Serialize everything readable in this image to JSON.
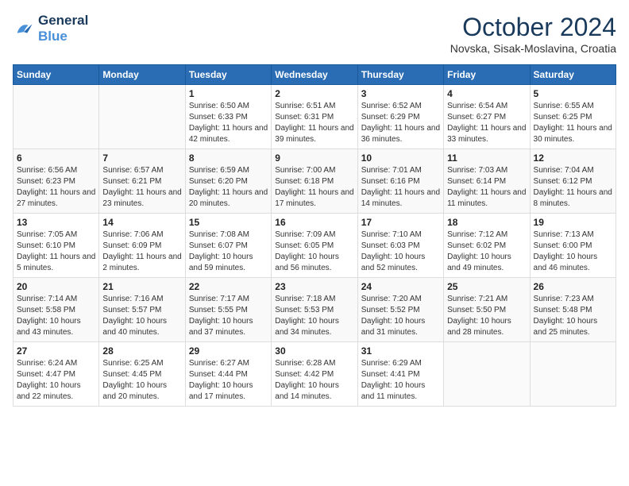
{
  "logo": {
    "line1": "General",
    "line2": "Blue"
  },
  "header": {
    "month": "October 2024",
    "location": "Novska, Sisak-Moslavina, Croatia"
  },
  "weekdays": [
    "Sunday",
    "Monday",
    "Tuesday",
    "Wednesday",
    "Thursday",
    "Friday",
    "Saturday"
  ],
  "weeks": [
    [
      {
        "day": "",
        "sunrise": "",
        "sunset": "",
        "daylight": ""
      },
      {
        "day": "",
        "sunrise": "",
        "sunset": "",
        "daylight": ""
      },
      {
        "day": "1",
        "sunrise": "Sunrise: 6:50 AM",
        "sunset": "Sunset: 6:33 PM",
        "daylight": "Daylight: 11 hours and 42 minutes."
      },
      {
        "day": "2",
        "sunrise": "Sunrise: 6:51 AM",
        "sunset": "Sunset: 6:31 PM",
        "daylight": "Daylight: 11 hours and 39 minutes."
      },
      {
        "day": "3",
        "sunrise": "Sunrise: 6:52 AM",
        "sunset": "Sunset: 6:29 PM",
        "daylight": "Daylight: 11 hours and 36 minutes."
      },
      {
        "day": "4",
        "sunrise": "Sunrise: 6:54 AM",
        "sunset": "Sunset: 6:27 PM",
        "daylight": "Daylight: 11 hours and 33 minutes."
      },
      {
        "day": "5",
        "sunrise": "Sunrise: 6:55 AM",
        "sunset": "Sunset: 6:25 PM",
        "daylight": "Daylight: 11 hours and 30 minutes."
      }
    ],
    [
      {
        "day": "6",
        "sunrise": "Sunrise: 6:56 AM",
        "sunset": "Sunset: 6:23 PM",
        "daylight": "Daylight: 11 hours and 27 minutes."
      },
      {
        "day": "7",
        "sunrise": "Sunrise: 6:57 AM",
        "sunset": "Sunset: 6:21 PM",
        "daylight": "Daylight: 11 hours and 23 minutes."
      },
      {
        "day": "8",
        "sunrise": "Sunrise: 6:59 AM",
        "sunset": "Sunset: 6:20 PM",
        "daylight": "Daylight: 11 hours and 20 minutes."
      },
      {
        "day": "9",
        "sunrise": "Sunrise: 7:00 AM",
        "sunset": "Sunset: 6:18 PM",
        "daylight": "Daylight: 11 hours and 17 minutes."
      },
      {
        "day": "10",
        "sunrise": "Sunrise: 7:01 AM",
        "sunset": "Sunset: 6:16 PM",
        "daylight": "Daylight: 11 hours and 14 minutes."
      },
      {
        "day": "11",
        "sunrise": "Sunrise: 7:03 AM",
        "sunset": "Sunset: 6:14 PM",
        "daylight": "Daylight: 11 hours and 11 minutes."
      },
      {
        "day": "12",
        "sunrise": "Sunrise: 7:04 AM",
        "sunset": "Sunset: 6:12 PM",
        "daylight": "Daylight: 11 hours and 8 minutes."
      }
    ],
    [
      {
        "day": "13",
        "sunrise": "Sunrise: 7:05 AM",
        "sunset": "Sunset: 6:10 PM",
        "daylight": "Daylight: 11 hours and 5 minutes."
      },
      {
        "day": "14",
        "sunrise": "Sunrise: 7:06 AM",
        "sunset": "Sunset: 6:09 PM",
        "daylight": "Daylight: 11 hours and 2 minutes."
      },
      {
        "day": "15",
        "sunrise": "Sunrise: 7:08 AM",
        "sunset": "Sunset: 6:07 PM",
        "daylight": "Daylight: 10 hours and 59 minutes."
      },
      {
        "day": "16",
        "sunrise": "Sunrise: 7:09 AM",
        "sunset": "Sunset: 6:05 PM",
        "daylight": "Daylight: 10 hours and 56 minutes."
      },
      {
        "day": "17",
        "sunrise": "Sunrise: 7:10 AM",
        "sunset": "Sunset: 6:03 PM",
        "daylight": "Daylight: 10 hours and 52 minutes."
      },
      {
        "day": "18",
        "sunrise": "Sunrise: 7:12 AM",
        "sunset": "Sunset: 6:02 PM",
        "daylight": "Daylight: 10 hours and 49 minutes."
      },
      {
        "day": "19",
        "sunrise": "Sunrise: 7:13 AM",
        "sunset": "Sunset: 6:00 PM",
        "daylight": "Daylight: 10 hours and 46 minutes."
      }
    ],
    [
      {
        "day": "20",
        "sunrise": "Sunrise: 7:14 AM",
        "sunset": "Sunset: 5:58 PM",
        "daylight": "Daylight: 10 hours and 43 minutes."
      },
      {
        "day": "21",
        "sunrise": "Sunrise: 7:16 AM",
        "sunset": "Sunset: 5:57 PM",
        "daylight": "Daylight: 10 hours and 40 minutes."
      },
      {
        "day": "22",
        "sunrise": "Sunrise: 7:17 AM",
        "sunset": "Sunset: 5:55 PM",
        "daylight": "Daylight: 10 hours and 37 minutes."
      },
      {
        "day": "23",
        "sunrise": "Sunrise: 7:18 AM",
        "sunset": "Sunset: 5:53 PM",
        "daylight": "Daylight: 10 hours and 34 minutes."
      },
      {
        "day": "24",
        "sunrise": "Sunrise: 7:20 AM",
        "sunset": "Sunset: 5:52 PM",
        "daylight": "Daylight: 10 hours and 31 minutes."
      },
      {
        "day": "25",
        "sunrise": "Sunrise: 7:21 AM",
        "sunset": "Sunset: 5:50 PM",
        "daylight": "Daylight: 10 hours and 28 minutes."
      },
      {
        "day": "26",
        "sunrise": "Sunrise: 7:23 AM",
        "sunset": "Sunset: 5:48 PM",
        "daylight": "Daylight: 10 hours and 25 minutes."
      }
    ],
    [
      {
        "day": "27",
        "sunrise": "Sunrise: 6:24 AM",
        "sunset": "Sunset: 4:47 PM",
        "daylight": "Daylight: 10 hours and 22 minutes."
      },
      {
        "day": "28",
        "sunrise": "Sunrise: 6:25 AM",
        "sunset": "Sunset: 4:45 PM",
        "daylight": "Daylight: 10 hours and 20 minutes."
      },
      {
        "day": "29",
        "sunrise": "Sunrise: 6:27 AM",
        "sunset": "Sunset: 4:44 PM",
        "daylight": "Daylight: 10 hours and 17 minutes."
      },
      {
        "day": "30",
        "sunrise": "Sunrise: 6:28 AM",
        "sunset": "Sunset: 4:42 PM",
        "daylight": "Daylight: 10 hours and 14 minutes."
      },
      {
        "day": "31",
        "sunrise": "Sunrise: 6:29 AM",
        "sunset": "Sunset: 4:41 PM",
        "daylight": "Daylight: 10 hours and 11 minutes."
      },
      {
        "day": "",
        "sunrise": "",
        "sunset": "",
        "daylight": ""
      },
      {
        "day": "",
        "sunrise": "",
        "sunset": "",
        "daylight": ""
      }
    ]
  ]
}
